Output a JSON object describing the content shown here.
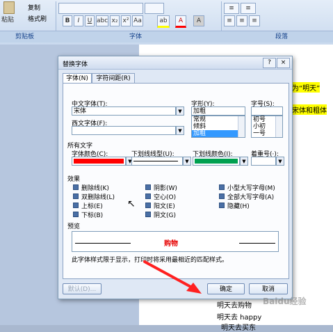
{
  "ribbon": {
    "paste_label": "粘贴",
    "copy_label": "复制",
    "format_painter_label": "格式刷",
    "clipboard_group": "剪贴板",
    "font_group": "字体",
    "paragraph_group": "段落",
    "bold": "B",
    "italic": "I",
    "underline": "U",
    "font_color_btn": "A",
    "highlight_btn": "ab"
  },
  "document": {
    "line1": "为“明天”",
    "line2": "宋体和粗体",
    "line3": "明天去购物",
    "line4": "明天去 happy",
    "line5": "明天去买东"
  },
  "dialog": {
    "title": "替换字体",
    "help_btn": "?",
    "close_btn": "×",
    "tabs": [
      "字体(N)",
      "字符间距(R)"
    ],
    "chinese_font_label": "中文字体(T):",
    "chinese_font_value": "宋体",
    "western_font_label": "西文字体(F):",
    "western_font_value": "",
    "style_label": "字形(Y):",
    "style_value": "加粗",
    "style_options": [
      "常规",
      "倾斜",
      "加粗"
    ],
    "style_selected": "加粗",
    "size_label": "字号(S):",
    "size_value": "",
    "size_options": [
      "初号",
      "小初",
      "一号"
    ],
    "all_text_section": "所有文字",
    "font_color_label": "字体颜色(C):",
    "font_color_value": "#ff0000",
    "underline_type_label": "下划线线型(U):",
    "underline_color_label": "下划线颜色(I):",
    "underline_color_value": "#00a050",
    "emphasis_label": "着重号(·):",
    "effects_section": "效果",
    "effects_col1": [
      "删除线(K)",
      "双删除线(L)",
      "上标(E)",
      "下标(B)"
    ],
    "effects_col2": [
      "阴影(W)",
      "空心(O)",
      "阳文(E)",
      "阴文(G)"
    ],
    "effects_col3": [
      "小型大写字母(M)",
      "全部大写字母(A)",
      "隐藏(H)"
    ],
    "preview_section": "预览",
    "preview_text": "购物",
    "preview_color": "#e60000",
    "note": "此字体样式限于显示，打印时将采用最相近的匹配样式。",
    "default_btn": "默认(D)...",
    "ok_btn": "确定",
    "cancel_btn": "取消"
  },
  "watermark": "Baidu经验"
}
